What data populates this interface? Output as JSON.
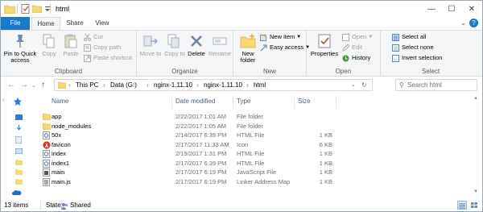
{
  "window": {
    "title": "html",
    "controls": {
      "minimize": "—",
      "maximize": "☐",
      "close": "✕"
    }
  },
  "tabs": {
    "file": "File",
    "home": "Home",
    "share": "Share",
    "view": "View",
    "help": "?"
  },
  "ribbon": {
    "clipboard": {
      "label": "Clipboard",
      "pin": "Pin to Quick access",
      "copy": "Copy",
      "paste": "Paste",
      "cut": "Cut",
      "copy_path": "Copy path",
      "paste_shortcut": "Paste shortcut"
    },
    "organize": {
      "label": "Organize",
      "move_to": "Move to",
      "copy_to": "Copy to",
      "delete": "Delete",
      "rename": "Rename"
    },
    "new": {
      "label": "New",
      "new_folder": "New folder",
      "new_item": "New item",
      "easy_access": "Easy access"
    },
    "open": {
      "label": "Open",
      "properties": "Properties",
      "open": "Open",
      "edit": "Edit",
      "history": "History"
    },
    "select": {
      "label": "Select",
      "select_all": "Select all",
      "select_none": "Select none",
      "invert": "Invert selection"
    }
  },
  "address": {
    "breadcrumbs": [
      "This PC",
      "Data (G:)",
      "nginx-1.11.10",
      "nginx-1.11.10",
      "html"
    ],
    "search_placeholder": "Search html"
  },
  "columns": {
    "name": "Name",
    "date": "Date modified",
    "type": "Type",
    "size": "Size"
  },
  "files": [
    {
      "name": "app",
      "date": "2/22/2017 1:01 AM",
      "type": "File folder",
      "size": "",
      "icon": "folder-icon"
    },
    {
      "name": "node_modules",
      "date": "2/22/2017 1:05 AM",
      "type": "File folder",
      "size": "",
      "icon": "folder-icon"
    },
    {
      "name": "50x",
      "date": "2/14/2017 6:39 PM",
      "type": "HTML File",
      "size": "1 KB",
      "icon": "html-file-icon"
    },
    {
      "name": "favicon",
      "date": "2/17/2017 11:33 AM",
      "type": "Icon",
      "size": "6 KB",
      "icon": "angular-icon"
    },
    {
      "name": "index",
      "date": "2/19/2017 1:31 PM",
      "type": "HTML File",
      "size": "1 KB",
      "icon": "html-file-icon"
    },
    {
      "name": "index1",
      "date": "2/17/2017 6:39 PM",
      "type": "HTML File",
      "size": "1 KB",
      "icon": "html-file-icon"
    },
    {
      "name": "main",
      "date": "2/17/2017 6:19 PM",
      "type": "JavaScript File",
      "size": "1 KB",
      "icon": "js-file-icon"
    },
    {
      "name": "main.js",
      "date": "2/17/2017 6:19 PM",
      "type": "Linker Address Map",
      "size": "1 KB",
      "icon": "map-file-icon"
    }
  ],
  "status": {
    "items": "13 items",
    "state_label": "State:",
    "state_value": "Shared"
  },
  "colors": {
    "accent": "#1979ca",
    "folder": "#f8d775",
    "header_text": "#4c607a"
  }
}
